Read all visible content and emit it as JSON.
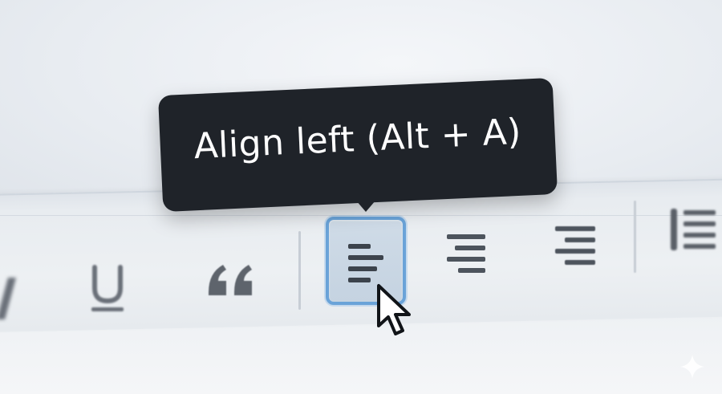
{
  "tooltip": {
    "text": "Align left (Alt + A)"
  },
  "toolbar": {
    "buttons": [
      {
        "name": "italic",
        "icon": "italic-icon"
      },
      {
        "name": "underline",
        "icon": "underline-icon"
      },
      {
        "name": "blockquote",
        "icon": "quote-icon"
      },
      {
        "name": "align-left",
        "icon": "align-left-icon",
        "state": "hover"
      },
      {
        "name": "align-center",
        "icon": "align-center-icon"
      },
      {
        "name": "align-right",
        "icon": "align-right-icon"
      },
      {
        "name": "list",
        "icon": "list-icon"
      }
    ]
  },
  "colors": {
    "tooltip_bg": "#1f2329",
    "tooltip_text": "#ffffff",
    "hover_border": "#6aa3d8",
    "hover_fill": "#c9d6e3",
    "icon": "#5a6068",
    "background": "#eceff3"
  }
}
